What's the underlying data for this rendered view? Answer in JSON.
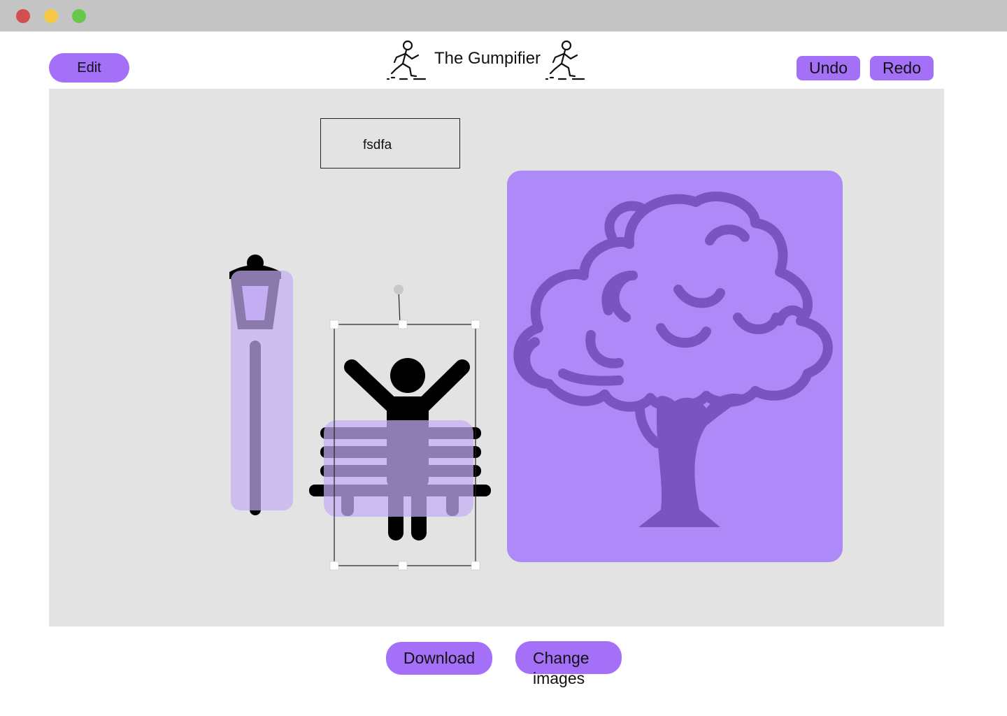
{
  "window": {
    "controls": [
      "close",
      "minimize",
      "maximize"
    ]
  },
  "header": {
    "title": "The Gumpifier",
    "edit_label": "Edit",
    "undo_label": "Undo",
    "redo_label": "Redo",
    "title_icon": "running-man-icon"
  },
  "canvas": {
    "text_box": "fsdfa",
    "layers": [
      "lamppost-icon",
      "bench-icon",
      "person-arms-up-icon",
      "tree-icon"
    ],
    "selected_layer": "person-arms-up-icon"
  },
  "footer": {
    "download_label": "Download",
    "change_images_label": "Change images"
  },
  "colors": {
    "accent": "#a370f7",
    "canvas_bg": "#e3e3e3",
    "titlebar": "#c4c4c4",
    "tree_card": "#ad8af7",
    "tree_stroke": "#7a55c2",
    "overlay": "#c5adf4"
  }
}
